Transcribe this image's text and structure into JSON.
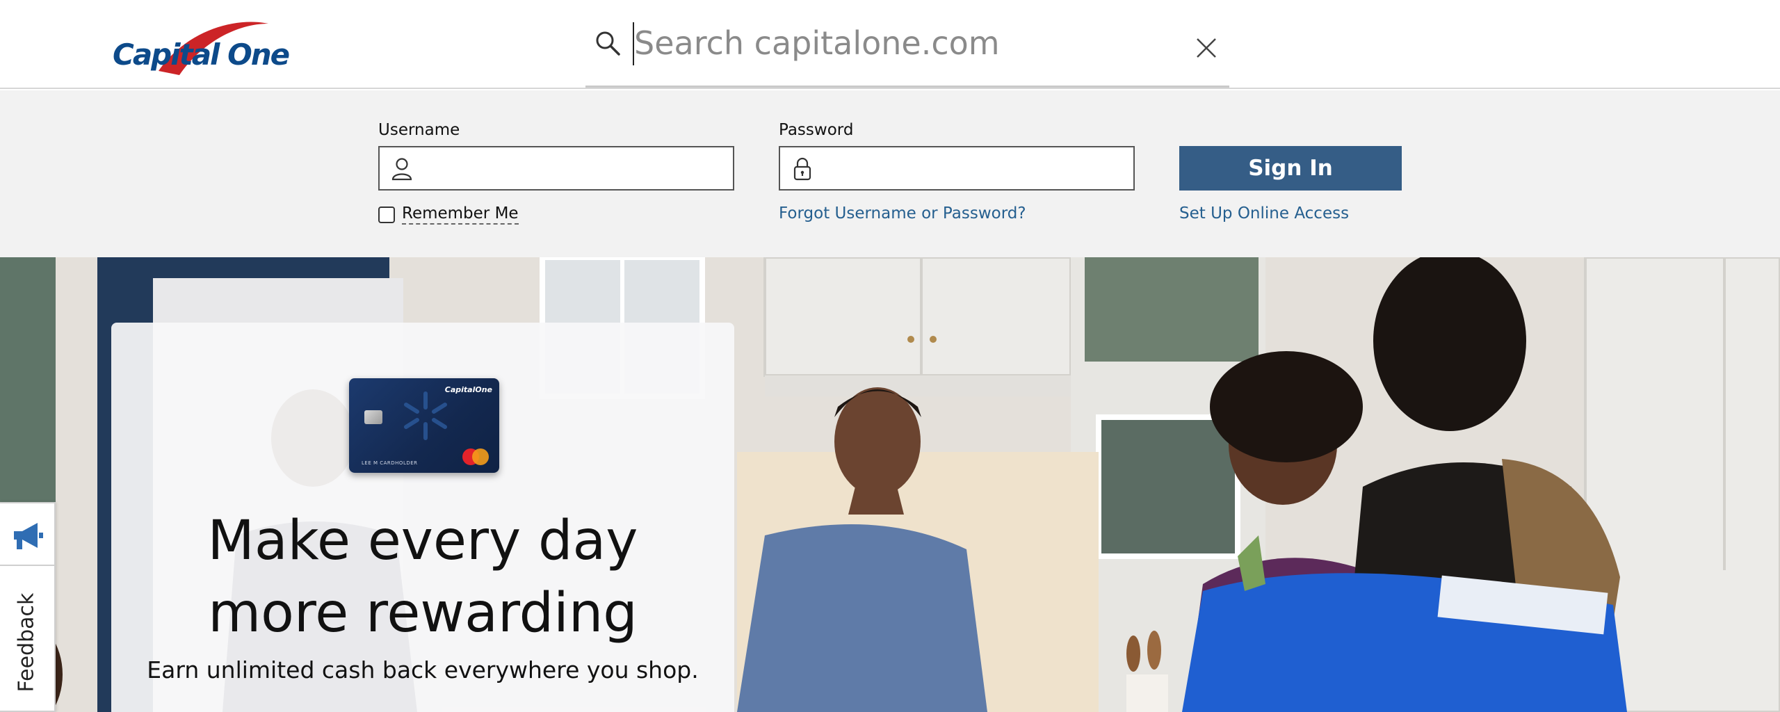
{
  "brand": {
    "logo_text": "Capital One"
  },
  "search": {
    "placeholder": "Search capitalone.com",
    "value": ""
  },
  "login": {
    "username_label": "Username",
    "password_label": "Password",
    "signin_label": "Sign In",
    "remember_label": "Remember Me",
    "remember_checked": false,
    "forgot_link": "Forgot Username or Password?",
    "setup_link": "Set Up Online Access"
  },
  "promo": {
    "card_brand": "CapitalOne",
    "card_holder": "LEE M CARDHOLDER",
    "title_line1": "Make every day",
    "title_line2": "more rewarding",
    "subtitle": "Earn unlimited cash back everywhere you shop."
  },
  "feedback": {
    "label": "Feedback"
  },
  "colors": {
    "brand_blue": "#0d4a8a",
    "brand_red": "#cc2427",
    "signin_bg": "#355d86",
    "link": "#255f8f",
    "band_bg": "#f2f2f2"
  }
}
